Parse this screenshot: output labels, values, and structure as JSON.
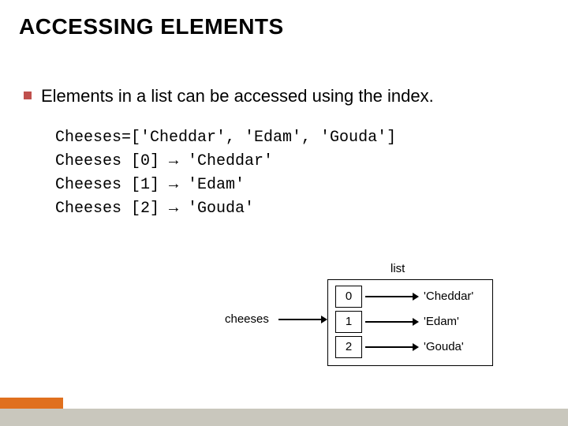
{
  "title": "ACCESSING ELEMENTS",
  "bullet": "Elements in a list can be accessed using the index.",
  "code": {
    "line1": "Cheeses=['Cheddar', 'Edam', 'Gouda']",
    "line2": "Cheeses [0] → 'Cheddar'",
    "line3": "Cheeses [1] → 'Edam'",
    "line4": "Cheeses [2] → 'Gouda'"
  },
  "diagram": {
    "list_label": "list",
    "var_name": "cheeses",
    "rows": [
      {
        "index": "0",
        "value": "'Cheddar'"
      },
      {
        "index": "1",
        "value": "'Edam'"
      },
      {
        "index": "2",
        "value": "'Gouda'"
      }
    ]
  }
}
